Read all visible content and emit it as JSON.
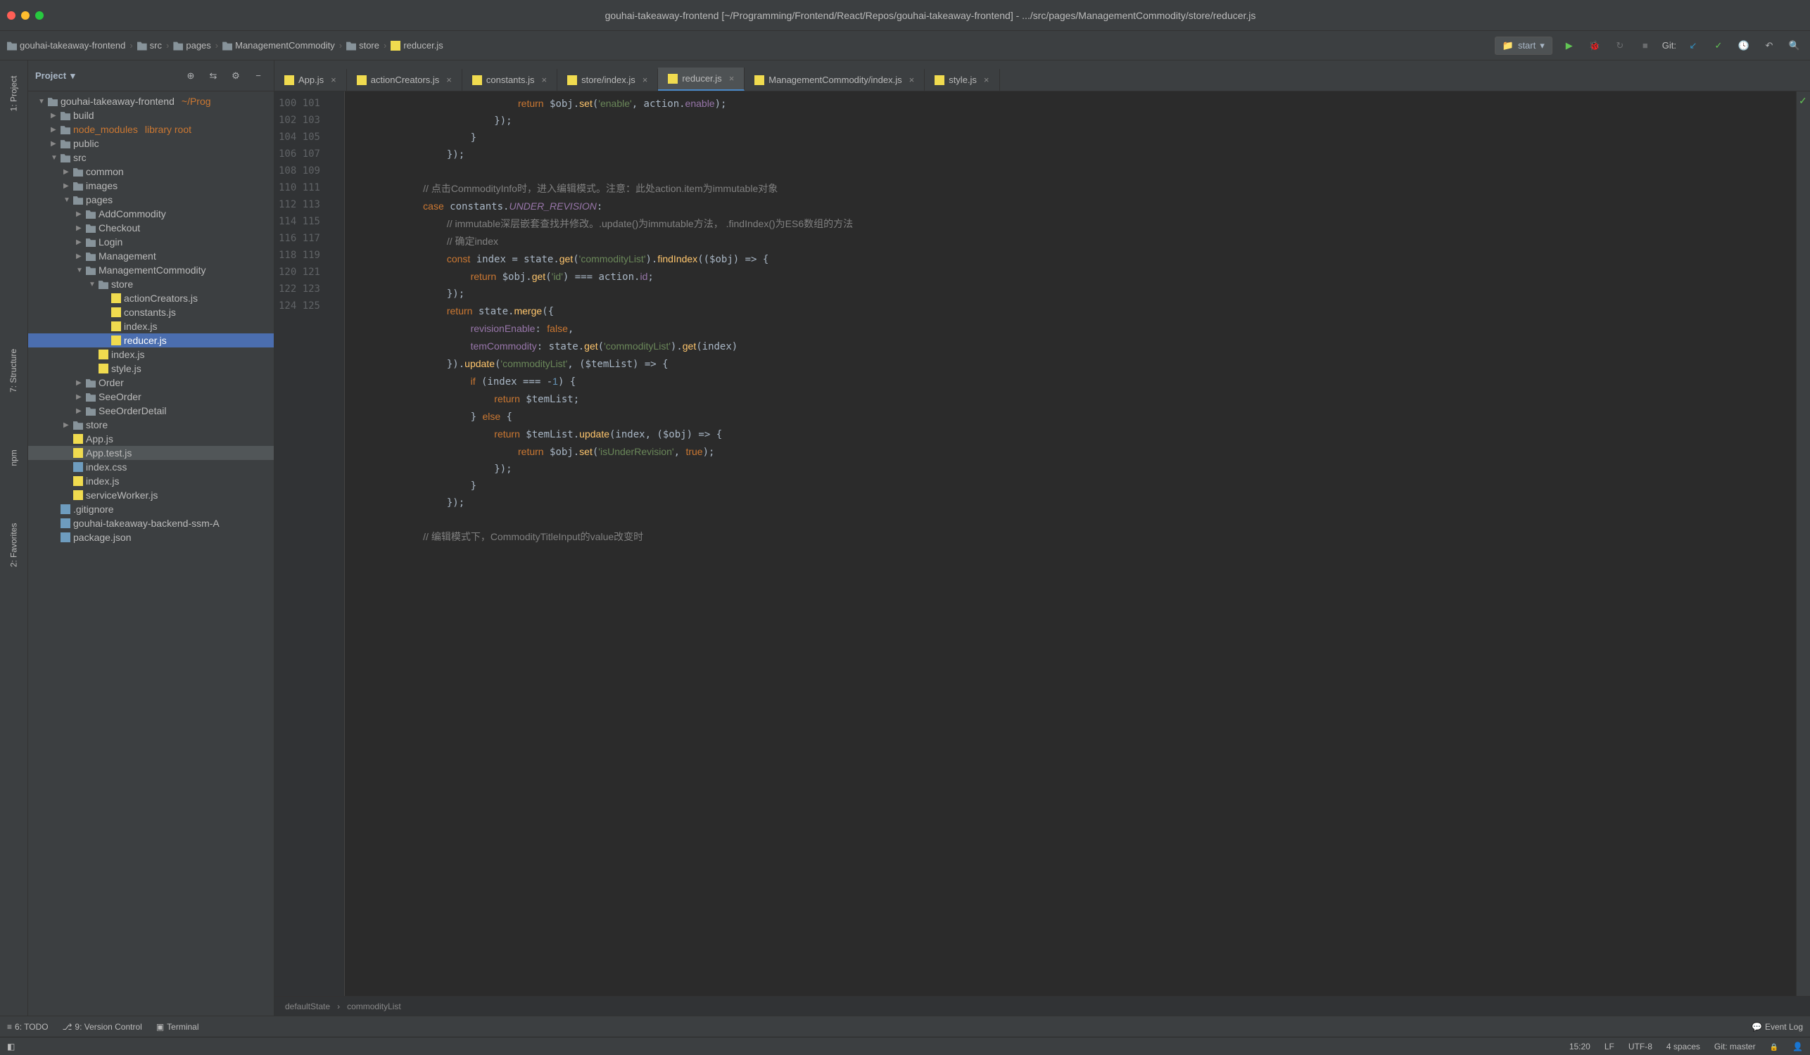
{
  "window_title": "gouhai-takeaway-frontend [~/Programming/Frontend/React/Repos/gouhai-takeaway-frontend] - .../src/pages/ManagementCommodity/store/reducer.js",
  "breadcrumbs": [
    "gouhai-takeaway-frontend",
    "src",
    "pages",
    "ManagementCommodity",
    "store",
    "reducer.js"
  ],
  "run_config": "start",
  "git_label": "Git:",
  "project_panel_title": "Project",
  "tree": {
    "root": "gouhai-takeaway-frontend",
    "root_path": "~/Prog",
    "items": [
      {
        "depth": 0,
        "arrow": "▼",
        "icon": "folder",
        "label": "gouhai-takeaway-frontend",
        "suffix": "~/Prog"
      },
      {
        "depth": 1,
        "arrow": "▶",
        "icon": "folder",
        "label": "build"
      },
      {
        "depth": 1,
        "arrow": "▶",
        "icon": "folder",
        "label": "node_modules",
        "suffix": "library root",
        "orange": true
      },
      {
        "depth": 1,
        "arrow": "▶",
        "icon": "folder",
        "label": "public"
      },
      {
        "depth": 1,
        "arrow": "▼",
        "icon": "folder",
        "label": "src"
      },
      {
        "depth": 2,
        "arrow": "▶",
        "icon": "folder",
        "label": "common"
      },
      {
        "depth": 2,
        "arrow": "▶",
        "icon": "folder",
        "label": "images"
      },
      {
        "depth": 2,
        "arrow": "▼",
        "icon": "folder",
        "label": "pages"
      },
      {
        "depth": 3,
        "arrow": "▶",
        "icon": "folder",
        "label": "AddCommodity"
      },
      {
        "depth": 3,
        "arrow": "▶",
        "icon": "folder",
        "label": "Checkout"
      },
      {
        "depth": 3,
        "arrow": "▶",
        "icon": "folder",
        "label": "Login"
      },
      {
        "depth": 3,
        "arrow": "▶",
        "icon": "folder",
        "label": "Management"
      },
      {
        "depth": 3,
        "arrow": "▼",
        "icon": "folder",
        "label": "ManagementCommodity"
      },
      {
        "depth": 4,
        "arrow": "▼",
        "icon": "folder",
        "label": "store"
      },
      {
        "depth": 5,
        "arrow": "",
        "icon": "js",
        "label": "actionCreators.js"
      },
      {
        "depth": 5,
        "arrow": "",
        "icon": "js",
        "label": "constants.js"
      },
      {
        "depth": 5,
        "arrow": "",
        "icon": "js",
        "label": "index.js"
      },
      {
        "depth": 5,
        "arrow": "",
        "icon": "js",
        "label": "reducer.js",
        "selected": true
      },
      {
        "depth": 4,
        "arrow": "",
        "icon": "js",
        "label": "index.js"
      },
      {
        "depth": 4,
        "arrow": "",
        "icon": "js",
        "label": "style.js"
      },
      {
        "depth": 3,
        "arrow": "▶",
        "icon": "folder",
        "label": "Order"
      },
      {
        "depth": 3,
        "arrow": "▶",
        "icon": "folder",
        "label": "SeeOrder"
      },
      {
        "depth": 3,
        "arrow": "▶",
        "icon": "folder",
        "label": "SeeOrderDetail"
      },
      {
        "depth": 2,
        "arrow": "▶",
        "icon": "folder",
        "label": "store"
      },
      {
        "depth": 2,
        "arrow": "",
        "icon": "js",
        "label": "App.js"
      },
      {
        "depth": 2,
        "arrow": "",
        "icon": "js",
        "label": "App.test.js",
        "highlighted": true
      },
      {
        "depth": 2,
        "arrow": "",
        "icon": "css",
        "label": "index.css"
      },
      {
        "depth": 2,
        "arrow": "",
        "icon": "js",
        "label": "index.js"
      },
      {
        "depth": 2,
        "arrow": "",
        "icon": "js",
        "label": "serviceWorker.js"
      },
      {
        "depth": 1,
        "arrow": "",
        "icon": "file",
        "label": ".gitignore"
      },
      {
        "depth": 1,
        "arrow": "",
        "icon": "md",
        "label": "gouhai-takeaway-backend-ssm-A"
      },
      {
        "depth": 1,
        "arrow": "",
        "icon": "json",
        "label": "package.json"
      }
    ]
  },
  "tabs": [
    {
      "label": "App.js"
    },
    {
      "label": "actionCreators.js"
    },
    {
      "label": "constants.js"
    },
    {
      "label": "store/index.js"
    },
    {
      "label": "reducer.js",
      "active": true
    },
    {
      "label": "ManagementCommodity/index.js"
    },
    {
      "label": "style.js"
    }
  ],
  "line_start": 100,
  "line_end": 125,
  "code_lines": [
    "                            <span class='kw'>return</span> $obj.<span class='fn'>set</span>(<span class='str'>'enable'</span>, action.<span class='purple'>enable</span>);",
    "                        });",
    "                    }",
    "                });",
    "",
    "            <span class='com'>// 点击CommodityInfo时，进入编辑模式。注意：此处action.item为immutable对象</span>",
    "            <span class='kw'>case</span> constants.<span class='id'>UNDER_REVISION</span>:",
    "                <span class='com'>// immutable深层嵌套查找并修改。.update()为immutable方法， .findIndex()为ES6数组的方法</span>",
    "                <span class='com'>// 确定index</span>",
    "                <span class='kw'>const</span> index = state.<span class='fn'>get</span>(<span class='str'>'commodityList'</span>).<span class='fn'>findIndex</span>(($obj) =&gt; {",
    "                    <span class='kw'>return</span> $obj.<span class='fn'>get</span>(<span class='str'>'id'</span>) === action.<span class='purple'>id</span>;",
    "                });",
    "                <span class='kw'>return</span> state.<span class='fn'>merge</span>({",
    "                    <span class='purple'>revisionEnable</span>: <span class='kw'>false</span>,",
    "                    <span class='purple'>temCommodity</span>: state.<span class='fn'>get</span>(<span class='str'>'commodityList'</span>).<span class='fn'>get</span>(index)",
    "                }).<span class='fn'>update</span>(<span class='str'>'commodityList'</span>, ($temList) =&gt; {",
    "                    <span class='kw'>if</span> (index === -<span class='num'>1</span>) {",
    "                        <span class='kw'>return</span> $temList;",
    "                    } <span class='kw'>else</span> {",
    "                        <span class='kw'>return</span> $temList.<span class='fn'>update</span>(index, ($obj) =&gt; {",
    "                            <span class='kw'>return</span> $obj.<span class='fn'>set</span>(<span class='str'>'isUnderRevision'</span>, <span class='kw'>true</span>);",
    "                        });",
    "                    }",
    "                });",
    "",
    "            <span class='com'>// 编辑模式下，CommodityTitleInput的value改变时</span>"
  ],
  "editor_breadcrumbs": [
    "defaultState",
    "commodityList"
  ],
  "tool_strip_left": [
    "1: Project",
    "7: Structure",
    "npm",
    "2: Favorites"
  ],
  "bottom_tools": [
    "6: TODO",
    "9: Version Control",
    "Terminal"
  ],
  "event_log": "Event Log",
  "status": {
    "pos": "15:20",
    "encoding_sep": "LF",
    "encoding": "UTF-8",
    "indent": "4 spaces",
    "git": "Git: master"
  }
}
